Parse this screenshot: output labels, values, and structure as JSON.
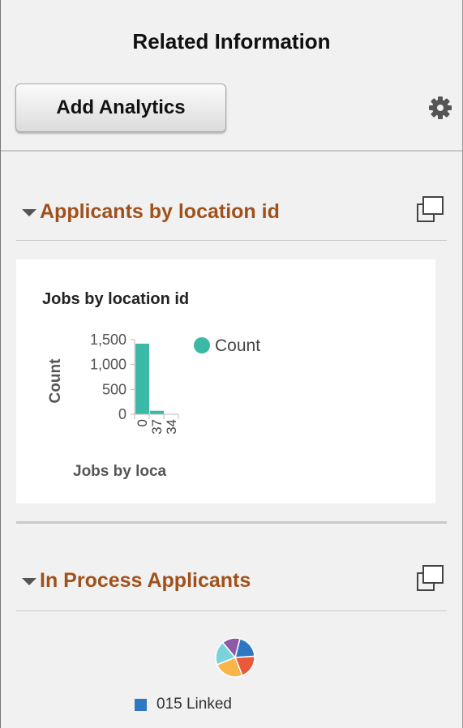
{
  "panel": {
    "title": "Related Information",
    "add_button": "Add Analytics",
    "settings_icon": "gear-icon"
  },
  "sections": [
    {
      "title": "Applicants by location id",
      "expand_icon": "triangle-down-icon",
      "maximize_icon": "maximize-icon",
      "chart_data": {
        "type": "bar",
        "title": "Jobs by location id",
        "xlabel": "Jobs by loca",
        "ylabel": "Count",
        "categories": [
          "0",
          "37",
          "34"
        ],
        "series": [
          {
            "name": "Count",
            "values": [
              1420,
              70,
              0
            ]
          }
        ],
        "ylim": [
          0,
          1500
        ],
        "yticks": [
          {
            "value": 0,
            "label": "0"
          },
          {
            "value": 500,
            "label": "500"
          },
          {
            "value": 1000,
            "label": "1,000"
          },
          {
            "value": 1500,
            "label": "1,500"
          }
        ],
        "legend": "right",
        "color": "#3cb8a6"
      }
    },
    {
      "title": "In Process Applicants",
      "expand_icon": "triangle-down-icon",
      "maximize_icon": "maximize-icon",
      "chart_data": {
        "type": "pie",
        "slices": [
          {
            "name": "015 Linked",
            "value": 20,
            "color": "#2e78c2"
          },
          {
            "name": "",
            "value": 20,
            "color": "#e95a3a"
          },
          {
            "name": "",
            "value": 25,
            "color": "#f7b54a"
          },
          {
            "name": "",
            "value": 20,
            "color": "#7ad3dc"
          },
          {
            "name": "",
            "value": 15,
            "color": "#8e5aa8"
          }
        ],
        "legend_label": "015 Linked",
        "legend_color": "#2e78c2"
      }
    }
  ]
}
